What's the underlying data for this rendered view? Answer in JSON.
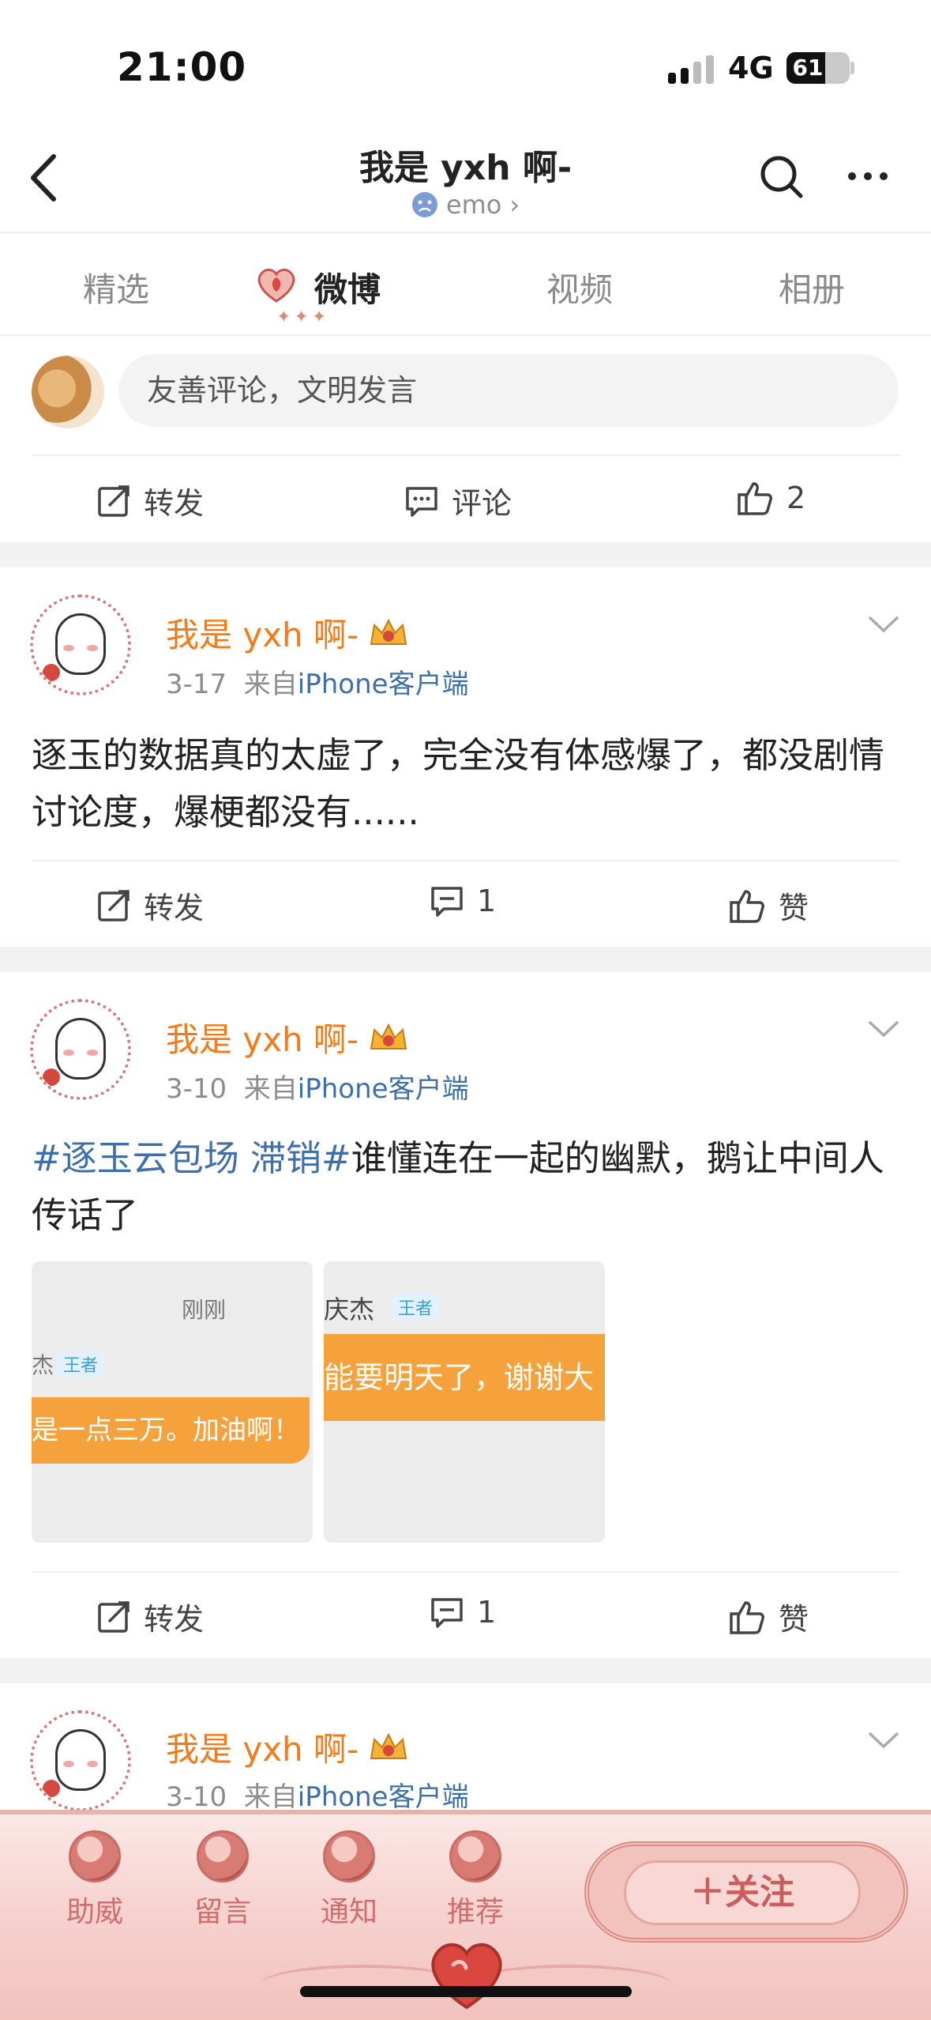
{
  "status_bar": {
    "time": "21:00",
    "network": "4G",
    "battery": "61",
    "battery_level": 0.61
  },
  "header": {
    "title": "我是 yxh 啊-",
    "subtitle": "emo",
    "subtitle_arrow": "›"
  },
  "tabs": [
    {
      "label": "精选",
      "active": false
    },
    {
      "label": "微博",
      "active": true
    },
    {
      "label": "视频",
      "active": false
    },
    {
      "label": "相册",
      "active": false
    }
  ],
  "tab_decoration": "✦✦✦",
  "comment_box": {
    "placeholder": "友善评论，文明发言"
  },
  "top_actions": {
    "repost": "转发",
    "comment": "评论",
    "like": "2"
  },
  "posts": [
    {
      "username": "我是 yxh 啊-",
      "date": "3-17",
      "from_prefix": "来自",
      "source": "iPhone客户端",
      "text": "逐玉的数据真的太虚了，完全没有体感爆了，都没剧情讨论度，爆梗都没有......",
      "repost": "转发",
      "comments": "1",
      "like": "赞"
    },
    {
      "username": "我是 yxh 啊-",
      "date": "3-10",
      "from_prefix": "来自",
      "source": "iPhone客户端",
      "topic": "#逐玉云包场 滞销#",
      "text": "谁懂连在一起的幽默，鹅让中间人传话了",
      "images": [
        {
          "caption": "刚刚",
          "name": "杰",
          "badge": "王者",
          "bubble": "是一点三万。加油啊！"
        },
        {
          "name": "庆杰",
          "badge": "王者",
          "bubble": "能要明天了，谢谢大"
        }
      ],
      "repost": "转发",
      "comments": "1",
      "like": "赞"
    },
    {
      "username": "我是 yxh 啊-",
      "date": "3-10",
      "from_prefix": "来自",
      "source": "iPhone客户端"
    }
  ],
  "bottom_bar": {
    "items": [
      "助威",
      "留言",
      "通知",
      "推荐"
    ],
    "follow": "＋关注"
  },
  "colors": {
    "username": "#f27a18",
    "link": "#3f6fa8",
    "bottom_theme": "#f6d3cf"
  }
}
